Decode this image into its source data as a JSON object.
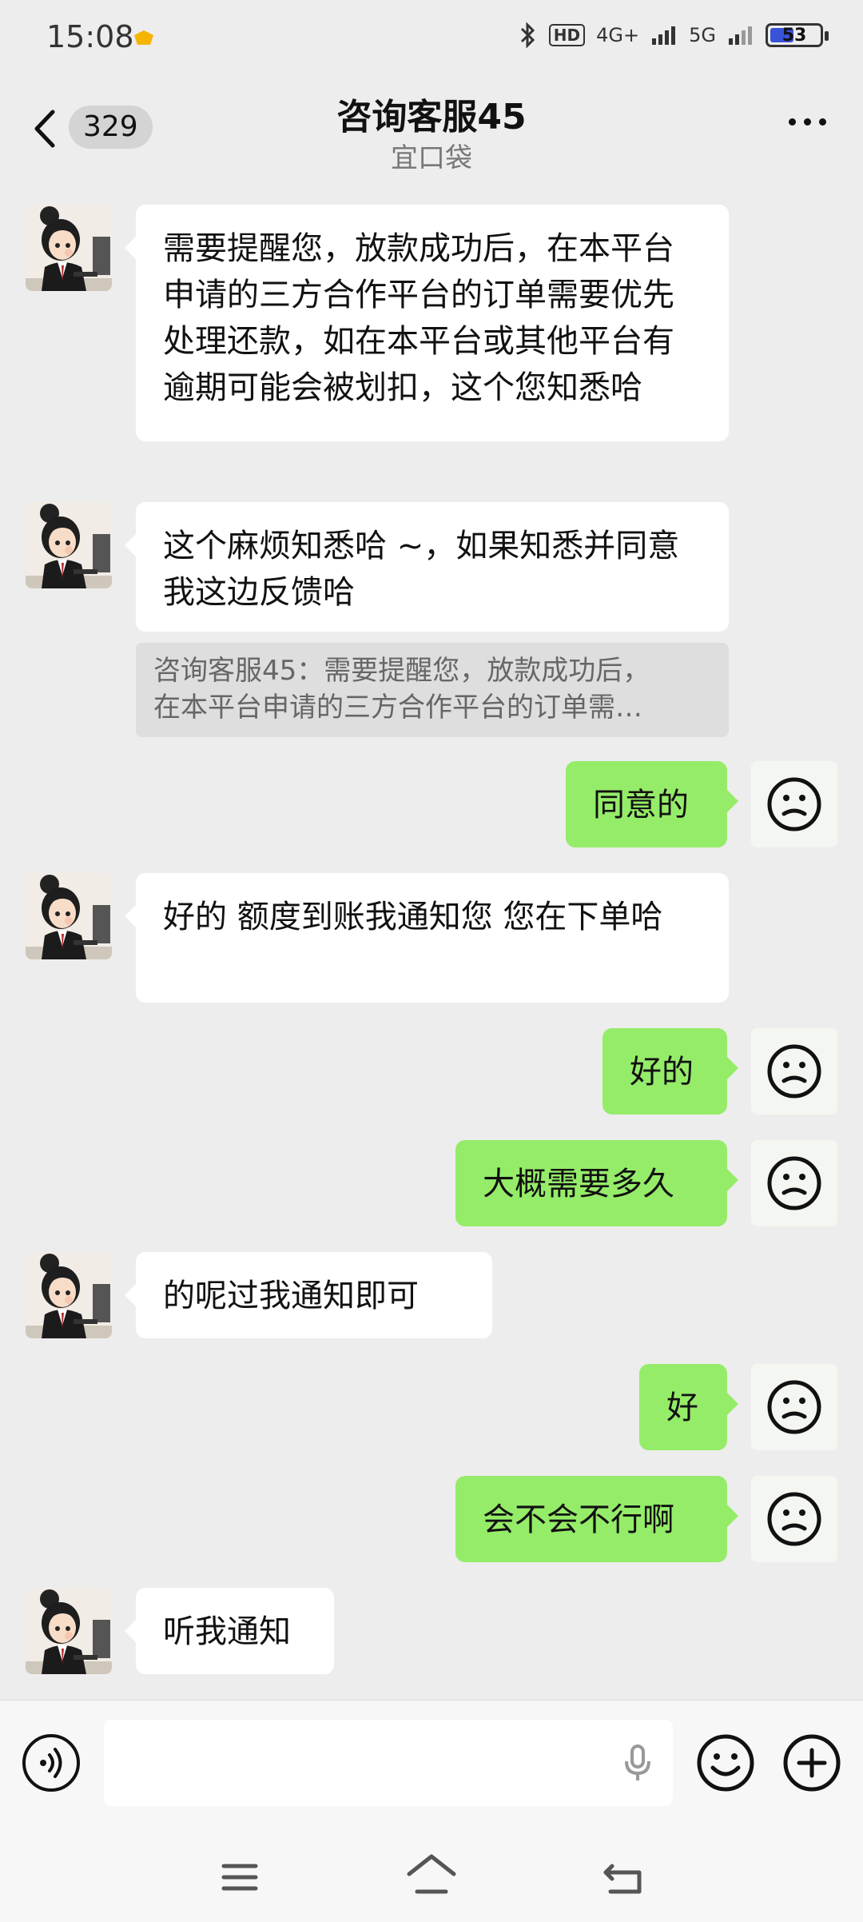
{
  "status_bar": {
    "time": "15:08",
    "hd_tag": "HD",
    "signal_4g": "4G+",
    "signal_5g": "5G",
    "battery": "53",
    "battery_level": 0.53
  },
  "header": {
    "unread_count": "329",
    "title": "咨询客服45",
    "subtitle": "宜口袋"
  },
  "messages": [
    {
      "side": "in",
      "text": "需要提醒您，放款成功后，在本平台申请的三方合作平台的订单需要优先处理还款，如在本平台或其他平台有逾期可能会被划扣，这个您知悉哈"
    },
    {
      "side": "in",
      "text": "这个麻烦知悉哈 ~，如果知悉并同意 我这边反馈哈",
      "quote_line1": "咨询客服45：需要提醒您，放款成功后，",
      "quote_line2": "在本平台申请的三方合作平台的订单需…"
    },
    {
      "side": "out",
      "text": "同意的"
    },
    {
      "side": "in",
      "text": "好的  额度到账我通知您 您在下单哈"
    },
    {
      "side": "out",
      "text": "好的"
    },
    {
      "side": "out",
      "text": "大概需要多久"
    },
    {
      "side": "in",
      "text": "的呢过我通知即可"
    },
    {
      "side": "out",
      "text": "好"
    },
    {
      "side": "out",
      "text": "会不会不行啊"
    },
    {
      "side": "in",
      "text": "听我通知"
    }
  ],
  "icons": {
    "back": "chevron-left-icon",
    "more": "more-dots-icon",
    "voice": "voice-icon",
    "mic": "microphone-icon",
    "emoji": "emoji-icon",
    "plus": "plus-icon"
  },
  "colors": {
    "outgoing_bubble": "#95ec69",
    "incoming_bubble": "#ffffff",
    "background": "#ededed"
  }
}
